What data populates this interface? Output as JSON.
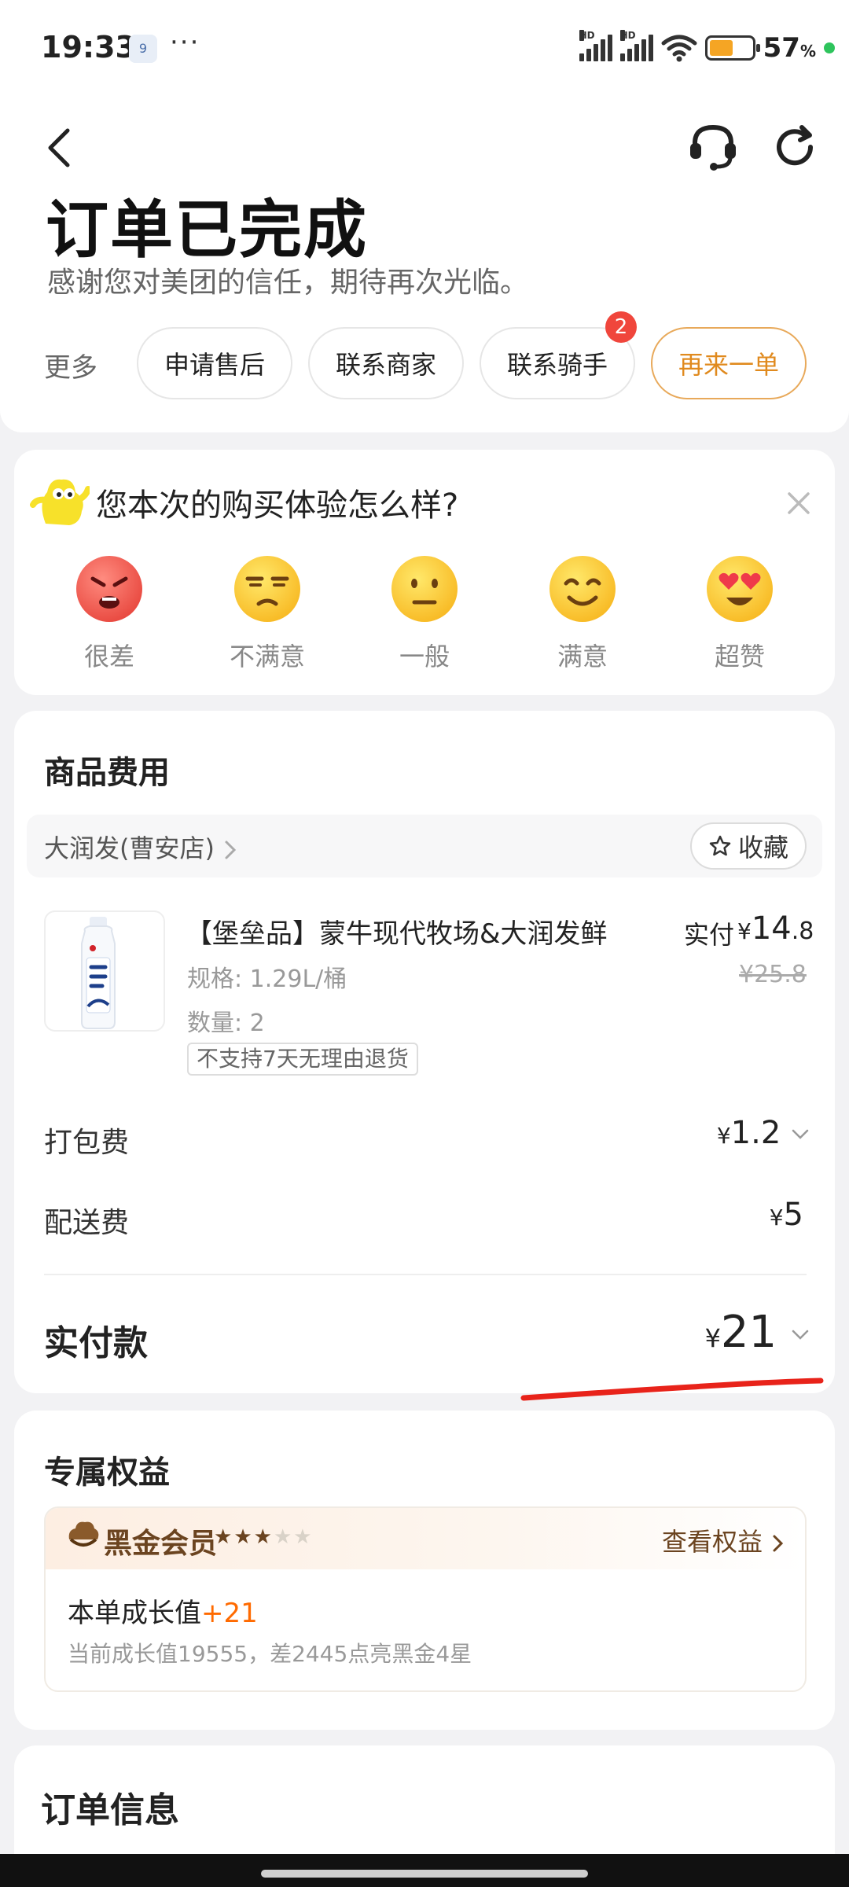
{
  "status_bar": {
    "time": "19:33",
    "notification_icon_text": "9",
    "dots": "···",
    "battery_percent": "57",
    "battery_level": 0.57,
    "battery_unit": "%",
    "network_label_1": "HD",
    "network_label_2": "HD"
  },
  "header": {
    "title": "订单已完成",
    "subtitle": "感谢您对美团的信任，期待再次光临。",
    "more_label": "更多",
    "actions": [
      {
        "label": "申请售后"
      },
      {
        "label": "联系商家"
      },
      {
        "label": "联系骑手",
        "badge": "2"
      },
      {
        "label": "再来一单"
      }
    ],
    "icons": {
      "back": "back-arrow-icon",
      "service": "customer-service-icon",
      "refresh": "refresh-icon"
    }
  },
  "rating": {
    "question": "您本次的购买体验怎么样?",
    "options": [
      {
        "label": "很差",
        "icon": "angry-face-icon"
      },
      {
        "label": "不满意",
        "icon": "unamused-face-icon"
      },
      {
        "label": "一般",
        "icon": "neutral-face-icon"
      },
      {
        "label": "满意",
        "icon": "smiling-face-icon"
      },
      {
        "label": "超赞",
        "icon": "heart-eyes-face-icon"
      }
    ]
  },
  "fees": {
    "title": "商品费用",
    "shop_name": "大润发(曹安店)",
    "favorite_label": "收藏",
    "product": {
      "name": "【堡垒品】蒙牛现代牧场&大润发鲜",
      "spec": "规格: 1.29L/桶",
      "quantity": "数量: 2",
      "tag": "不支持7天无理由退货",
      "pay_label": "实付",
      "pay_yen": "¥",
      "pay_int": "14",
      "pay_dec": ".8",
      "original_price": "¥25.8"
    },
    "packing": {
      "label": "打包费",
      "yen": "¥",
      "value": "1.2"
    },
    "delivery": {
      "label": "配送费",
      "yen": "¥",
      "value": "5"
    },
    "total": {
      "label": "实付款",
      "yen": "¥",
      "value": "21"
    }
  },
  "benefits": {
    "title": "专属权益",
    "member_title": "黑金会员",
    "member_stars": "★★★★★",
    "member_star_level": 3,
    "member_star_total": 5,
    "link_label": "查看权益",
    "growth_label": "本单成长值",
    "growth_value": "+21",
    "growth_desc": "当前成长值19555，差2445点亮黑金4星"
  },
  "order_info": {
    "title": "订单信息"
  },
  "colors": {
    "accent": "#e08a1e",
    "badge": "#f0463c",
    "annotation": "#e8231a",
    "member_brown": "#6b4420"
  }
}
